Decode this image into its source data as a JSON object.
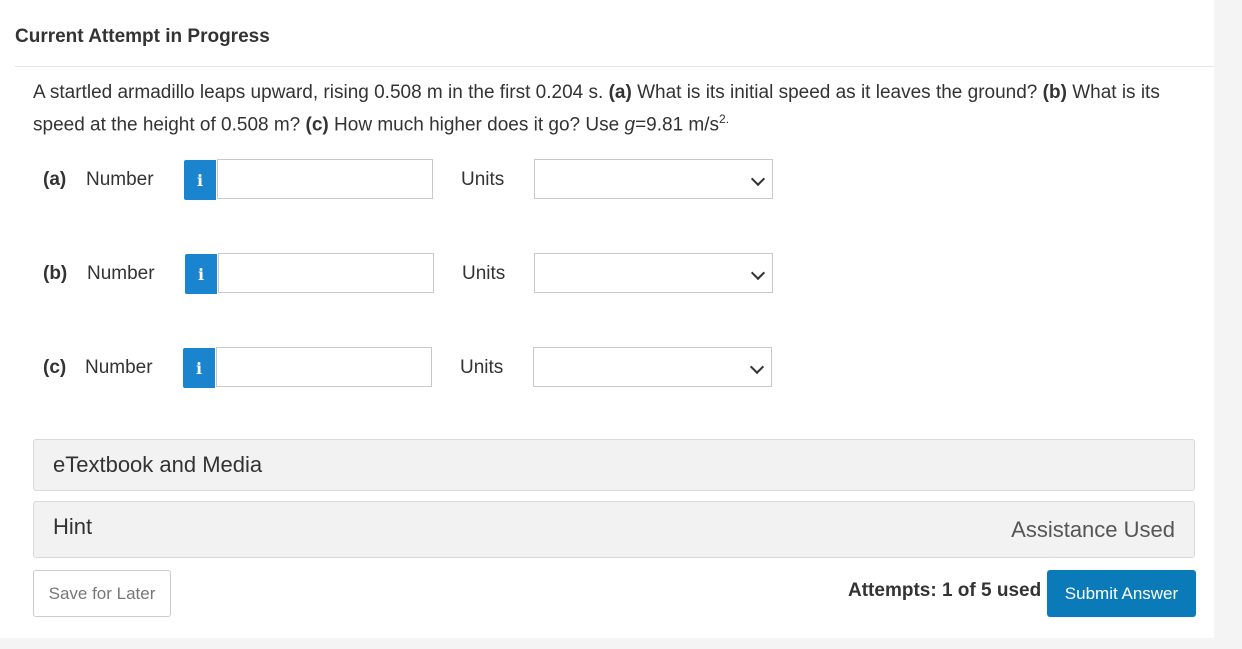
{
  "header": {
    "title": "Current Attempt in Progress"
  },
  "question": {
    "intro": "A startled armadillo leaps upward, rising 0.508 m in the first 0.204 s. ",
    "a_label": "(a)",
    "a_text": " What is its initial speed as it leaves the ground? ",
    "b_label": "(b)",
    "b_text": " What is its speed at the height of 0.508 m? ",
    "c_label": "(c)",
    "c_text": " How much higher does it go? Use ",
    "g_var": "g",
    "g_value": "=9.81 m/s",
    "g_exp": "2."
  },
  "parts": [
    {
      "label": "(a)",
      "number_label": "Number",
      "info": "i",
      "value": "",
      "units_label": "Units",
      "units_value": ""
    },
    {
      "label": "(b)",
      "number_label": "Number",
      "info": "i",
      "value": "",
      "units_label": "Units",
      "units_value": ""
    },
    {
      "label": "(c)",
      "number_label": "Number",
      "info": "i",
      "value": "",
      "units_label": "Units",
      "units_value": ""
    }
  ],
  "etextbook": {
    "label": "eTextbook and Media"
  },
  "hint": {
    "label": "Hint",
    "assistance": "Assistance Used"
  },
  "footer": {
    "save_label": "Save for Later",
    "attempts": "Attempts: 1 of 5 used",
    "submit_label": "Submit Answer"
  }
}
